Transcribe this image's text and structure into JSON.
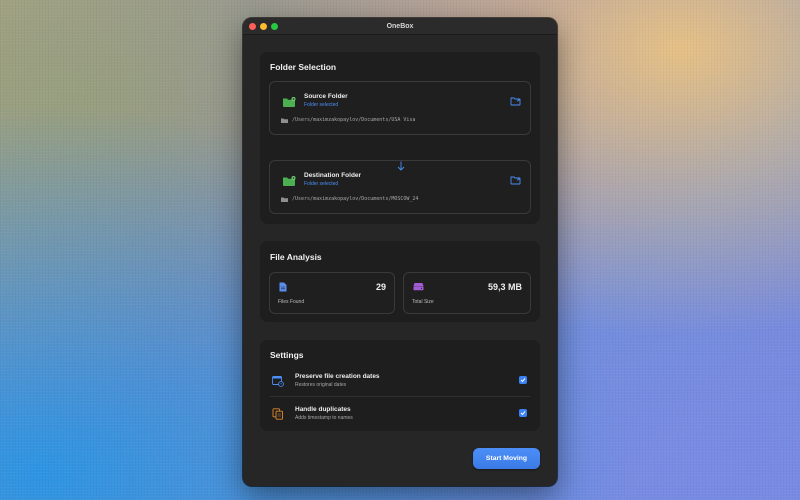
{
  "window": {
    "title": "OneBox"
  },
  "folder_selection": {
    "heading": "Folder Selection",
    "source": {
      "label": "Source Folder",
      "status": "Folder selected",
      "path": "/Users/maximzakopaylov/Documents/USA Visa"
    },
    "destination": {
      "label": "Destination Folder",
      "status": "Folder selected",
      "path": "/Users/maximzakopaylov/Documents/MOSCOW_24"
    }
  },
  "file_analysis": {
    "heading": "File Analysis",
    "files_found": {
      "value": "29",
      "label": "Files Found"
    },
    "total_size": {
      "value": "59,3 MB",
      "label": "Total Size"
    }
  },
  "settings": {
    "heading": "Settings",
    "items": [
      {
        "label": "Preserve file creation dates",
        "sub": "Restores original dates",
        "checked": true,
        "icon": "calendar-clock-icon"
      },
      {
        "label": "Handle duplicates",
        "sub": "Adds timestamp to names",
        "checked": true,
        "icon": "duplicate-docs-icon"
      }
    ]
  },
  "actions": {
    "start_label": "Start Moving"
  },
  "colors": {
    "accent": "#4c8ef7",
    "folder_green": "#4caf50",
    "files_icon_blue": "#5b8def",
    "size_icon_purple": "#a45bd6",
    "duplicates_orange": "#e08a2c"
  }
}
